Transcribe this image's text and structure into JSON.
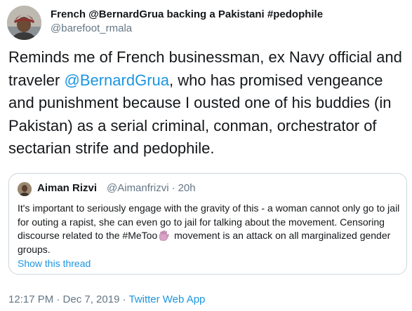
{
  "tweet": {
    "display_name": "French @BernardGrua backing a Pakistani #pedophile",
    "handle": "@barefoot_rmala",
    "text": {
      "part1": "Reminds me of French businessman, ex Navy official and traveler ",
      "mention": "@BernardGrua",
      "part2": ", who has promised vengeance and punishment because I ousted one of his buddies (in Pakistan) as a serial criminal, conman, orchestrator of sectarian strife and pedophile."
    },
    "timestamp": "12:17 PM · Dec 7, 2019",
    "separator": "·",
    "source": "Twitter Web App"
  },
  "quoted_tweet": {
    "name": "Aiman Rizvi",
    "handle": "@Aimanfrizvi",
    "separator": "·",
    "time": "20h",
    "text_part1": "It's important to seriously engage with the gravity of this - a woman cannot only go to jail for outing a rapist, she can even go to jail for talking about the movement. Censoring discourse related to the #MeToo",
    "emoji": "raised-hand-emoji",
    "text_part2": " movement is an attack on all marginalized gender groups.",
    "show_thread": "Show this thread"
  },
  "colors": {
    "text": "#14171a",
    "secondary": "#657786",
    "link": "#1b95e0",
    "border": "#ccd6dd"
  }
}
